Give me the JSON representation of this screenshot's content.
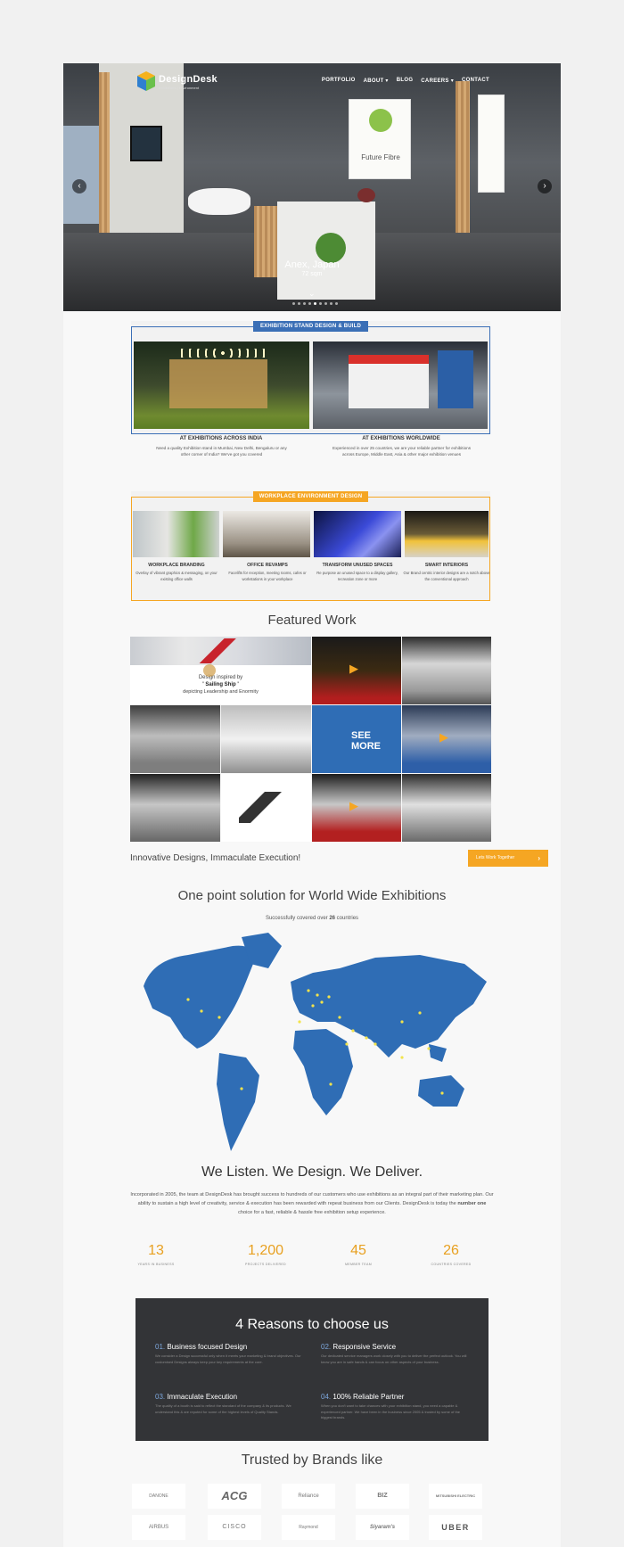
{
  "header": {
    "logo_text": "DesignDesk",
    "logo_tagline": "Exhibitions | Environment",
    "nav": [
      "PORTFOLIO",
      "ABOUT ▾",
      "BLOG",
      "CAREERS ▾",
      "CONTACT"
    ]
  },
  "hero": {
    "caption_title": "Anex, Japan",
    "caption_sub": "72 sqm",
    "booth_text": "Future Fibre",
    "prev_icon": "‹",
    "next_icon": "›",
    "down_icon": "⌄"
  },
  "exhibition": {
    "badge": "EXHIBITION STAND DESIGN & BUILD",
    "cols": [
      {
        "title": "AT EXHIBITIONS ACROSS INDIA",
        "text": "Need a quality Exhibition stand in Mumbai, New Delhi, Bengaluru or any other corner of India? We've got you covered"
      },
      {
        "title": "AT EXHIBITIONS WORLDWIDE",
        "text": "Experienced in over 25 countries, we are your reliable partner for exhibitions across Europe, Middle East, Asia & other major exhibition venues"
      }
    ]
  },
  "workplace": {
    "badge": "WORKPLACE ENVIRONMENT DESIGN",
    "cols": [
      {
        "title": "WORKPLACE BRANDING",
        "text": "Overlay of vibrant graphics & messaging, on your existing office walls"
      },
      {
        "title": "OFFICE REVAMPS",
        "text": "Facelifts for reception, meeting rooms, cafes or workstations in your workplace"
      },
      {
        "title": "TRANSFORM UNUSED SPACES",
        "text": "Re purpose an unused space to a display gallery, recreation zone or more"
      },
      {
        "title": "SMART INTERIORS",
        "text": "Our Brand centric interior designs are a notch above the conventional approach"
      }
    ]
  },
  "featured": {
    "title": "Featured Work",
    "sailing_line1": "Design inspired by",
    "sailing_line2": "' Sailing Ship '",
    "sailing_line3": "depicting Leadership and Enormity",
    "see_more": "SEE MORE",
    "play_icon": "▶"
  },
  "cta": {
    "text": "Innovative Designs, Immaculate Execution!",
    "button": "Lets Work Together",
    "button_icon": "›"
  },
  "map": {
    "title": "One point solution for World Wide Exhibitions",
    "sub_prefix": "Successfully covered over ",
    "sub_count": "26",
    "sub_suffix": " countries",
    "land_color": "#2f6db5",
    "marker_color": "#f2e34b"
  },
  "about": {
    "title": "We Listen. We Design. We Deliver.",
    "text_a": "Incorporated in 2005, the team at DesignDesk has brought success to hundreds of our customers who use exhibitions as an integral part of their marketing plan. Our ability to sustain a high level of creativity, service & execution has been rewarded with repeat business from our Clients. DesignDesk is today the ",
    "text_bold": "number one",
    "text_b": " choice for a fast, reliable & hassle free exhibition setup experience."
  },
  "stats": [
    {
      "value": "13",
      "label": "YEARS IN BUSINESS"
    },
    {
      "value": "1,200",
      "label": "PROJECTS DELIVERED"
    },
    {
      "value": "45",
      "label": "MEMBER TEAM"
    },
    {
      "value": "26",
      "label": "COUNTRIES COVERED"
    }
  ],
  "reasons": {
    "title": "4 Reasons to choose us",
    "items": [
      {
        "num": "01.",
        "title": "Business focused Design",
        "text": "We consider a Design successful only when it meets your marketing & brand objectives. Our customised Designs always keep your key requirements at the core."
      },
      {
        "num": "02.",
        "title": "Responsive Service",
        "text": "Our dedicated service managers work closely with you to deliver the perfect outlook. You will know you are in safe hands & can focus on other aspects of your business."
      },
      {
        "num": "03.",
        "title": "Immaculate Execution",
        "text": "The quality of a booth is said to reflect the standard of the company & its products. We understand this & are reputed for some of the highest levels of Quality Stands."
      },
      {
        "num": "04.",
        "title": "100% Reliable Partner",
        "text": "When you don't want to take chances with your exhibition stand, you need a capable & experienced partner. We have been in the business since 2005 & trusted by some of the biggest brands."
      }
    ]
  },
  "brands": {
    "title": "Trusted by Brands like",
    "row1": [
      "DANONE",
      "ACG",
      "Reliance",
      "BIZ",
      "MITSUBISHI ELECTRIC"
    ],
    "row2": [
      "AIRBUS",
      "CISCO",
      "Raymond",
      "Siyaram's",
      "UBER"
    ]
  }
}
